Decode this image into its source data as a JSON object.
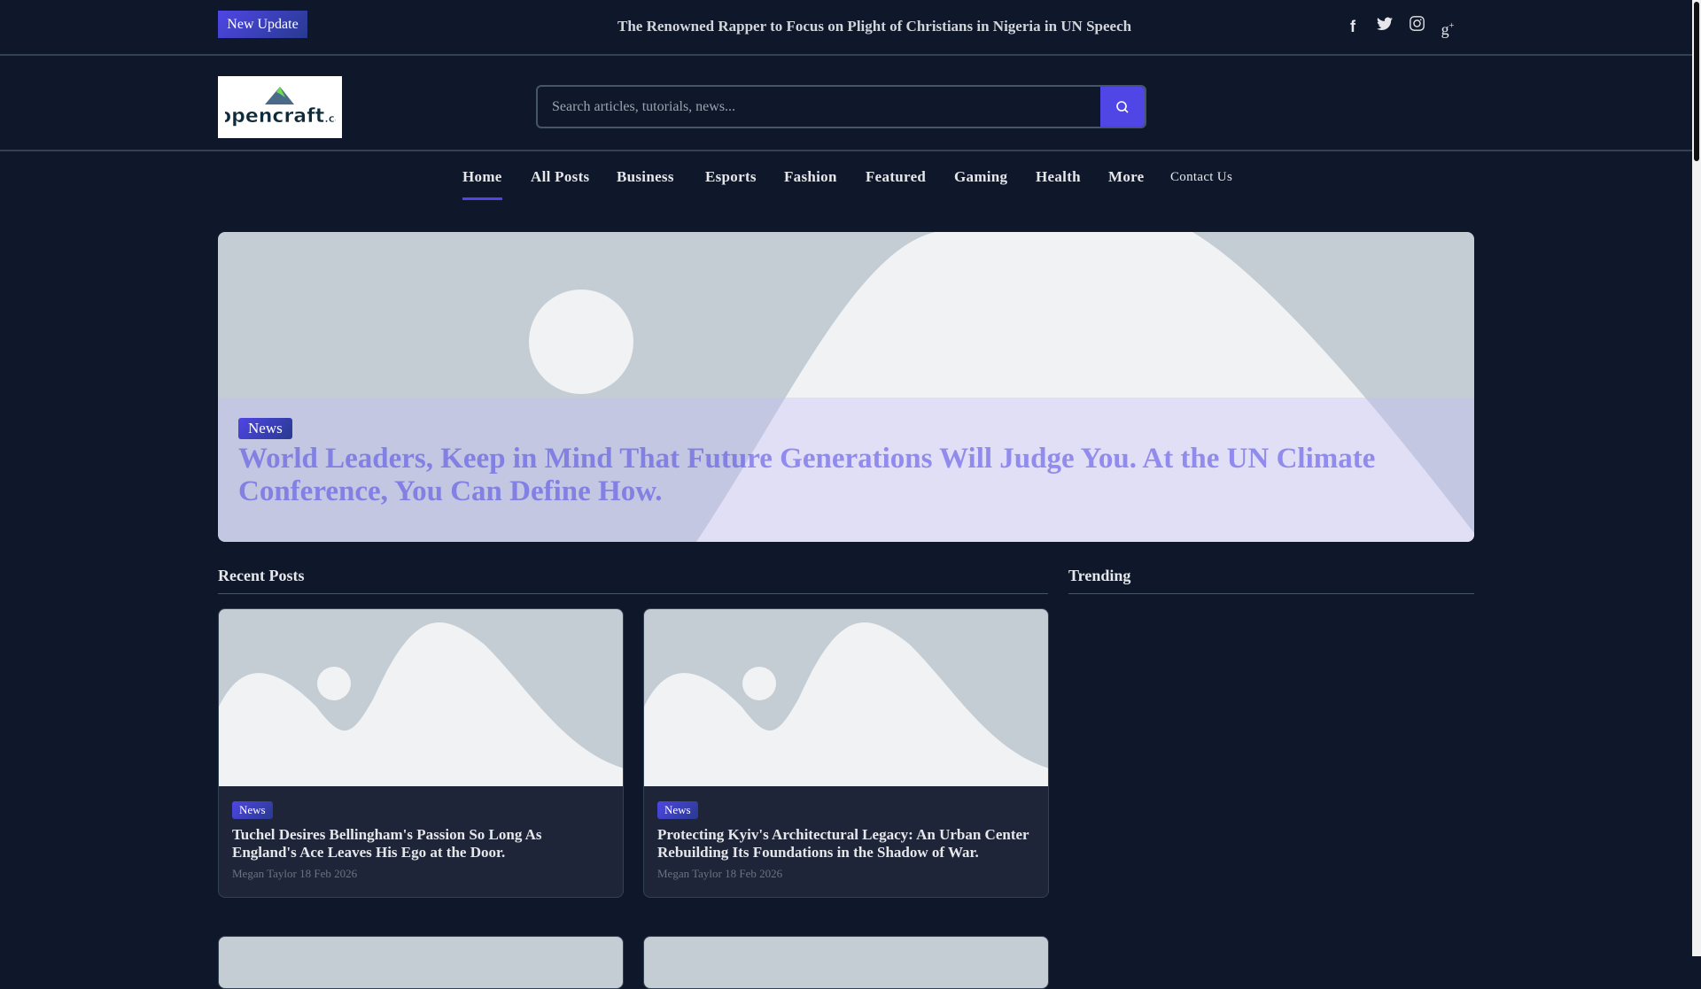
{
  "topbar": {
    "badge": "New Update",
    "ticker": "The Renowned Rapper to Focus on Plight of Christians in Nigeria in UN Speech",
    "social": [
      "facebook-icon",
      "twitter-icon",
      "instagram-icon",
      "google-plus-icon"
    ]
  },
  "header": {
    "logo_text": "opencraft.ca",
    "search_placeholder": "Search articles, tutorials, news..."
  },
  "nav": [
    "Home",
    "All Posts",
    "Business",
    "Esports",
    "Fashion",
    "Featured",
    "Gaming",
    "Health",
    "More",
    "Contact Us"
  ],
  "hero": {
    "category": "News",
    "title": "World Leaders, Keep in Mind That Future Generations Will Judge You. At the UN Climate Conference, You Can Define How."
  },
  "recent": {
    "heading": "Recent Posts",
    "posts": [
      {
        "category": "News",
        "title": "Tuchel Desires Bellingham's Passion So Long As England's Ace Leaves His Ego at the Door.",
        "author": "Megan Taylor",
        "date": "18 Feb 2026"
      },
      {
        "category": "News",
        "title": "Protecting Kyiv's Architectural Legacy: An Urban Center Rebuilding Its Foundations in the Shadow of War.",
        "author": "Megan Taylor",
        "date": "18 Feb 2026"
      }
    ]
  },
  "trending": {
    "heading": "Trending"
  },
  "colors": {
    "bg": "#0f172a",
    "accent": "#4f46e5"
  }
}
